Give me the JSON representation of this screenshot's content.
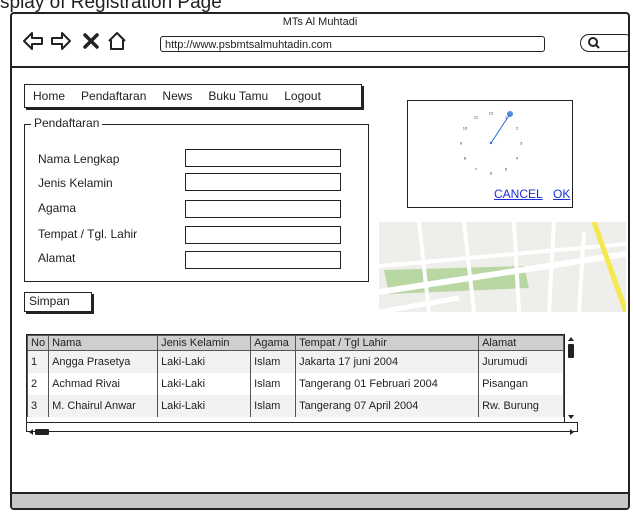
{
  "caption": "splay of Registration Page",
  "window": {
    "title": "MTs Al Muhtadi",
    "url": "http://www.psbmtsalmuhtadin.com",
    "icons": [
      "back-arrow-icon",
      "forward-arrow-icon",
      "close-x-icon",
      "home-icon",
      "search-icon"
    ]
  },
  "menu": {
    "items": [
      "Home",
      "Pendaftaran",
      "News",
      "Buku Tamu",
      "Logout"
    ]
  },
  "form": {
    "legend": "Pendaftaran",
    "fields": [
      {
        "label": "Nama Lengkap",
        "value": ""
      },
      {
        "label": "Jenis Kelamin",
        "value": ""
      },
      {
        "label": "Agama",
        "value": ""
      },
      {
        "label": "Tempat / Tgl. Lahir",
        "value": ""
      },
      {
        "label": "Alamat",
        "value": ""
      }
    ],
    "save_label": "Simpan"
  },
  "clock_dialog": {
    "numbers": [
      "12",
      "1",
      "2",
      "3",
      "4",
      "5",
      "6",
      "7",
      "8",
      "9",
      "10",
      "11"
    ],
    "selected_hour": 1,
    "cancel_label": "CANCEL",
    "ok_label": "OK",
    "accent": "#2b6fd6"
  },
  "map": {
    "colors": {
      "land": "#eeeeea",
      "road": "#ffffff",
      "highway": "#f4e84a",
      "park": "#b9d7a3"
    }
  },
  "table": {
    "headers": [
      "No",
      "Nama",
      "Jenis Kelamin",
      "Agama",
      "Tempat / Tgl Lahir",
      "Alamat"
    ],
    "rows": [
      [
        "1",
        "Angga Prasetya",
        "Laki-Laki",
        "Islam",
        "Jakarta 17 juni 2004",
        "Jurumudi"
      ],
      [
        "2",
        "Achmad Rivai",
        "Laki-Laki",
        "Islam",
        "Tangerang 01 Februari 2004",
        "Pisangan"
      ],
      [
        "3",
        "M. Chairul Anwar",
        "Laki-Laki",
        "Islam",
        "Tangerang 07 April 2004",
        "Rw. Burung"
      ]
    ]
  }
}
